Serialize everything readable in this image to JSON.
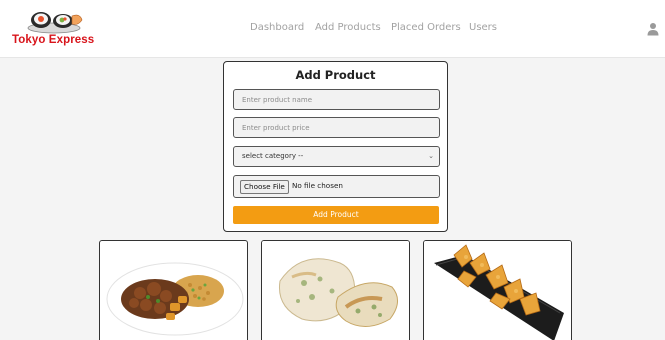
{
  "brand": {
    "name": "Tokyo Express",
    "color": "#d8141b"
  },
  "nav": {
    "items": [
      {
        "label": "Dashboard"
      },
      {
        "label": "Add Products"
      },
      {
        "label": "Placed Orders"
      },
      {
        "label": "Users"
      }
    ]
  },
  "user_icon": "user-icon",
  "form": {
    "title": "Add Product",
    "name_placeholder": "Enter product name",
    "price_placeholder": "Enter product price",
    "category_selected": "select category --",
    "file_button": "Choose File",
    "file_status": "No file chosen",
    "submit_label": "Add Product",
    "accent": "#f39c12"
  },
  "products": [
    {
      "image": "fried-rice-plate"
    },
    {
      "image": "dumplings"
    },
    {
      "image": "crab-rangoon-tray"
    }
  ]
}
